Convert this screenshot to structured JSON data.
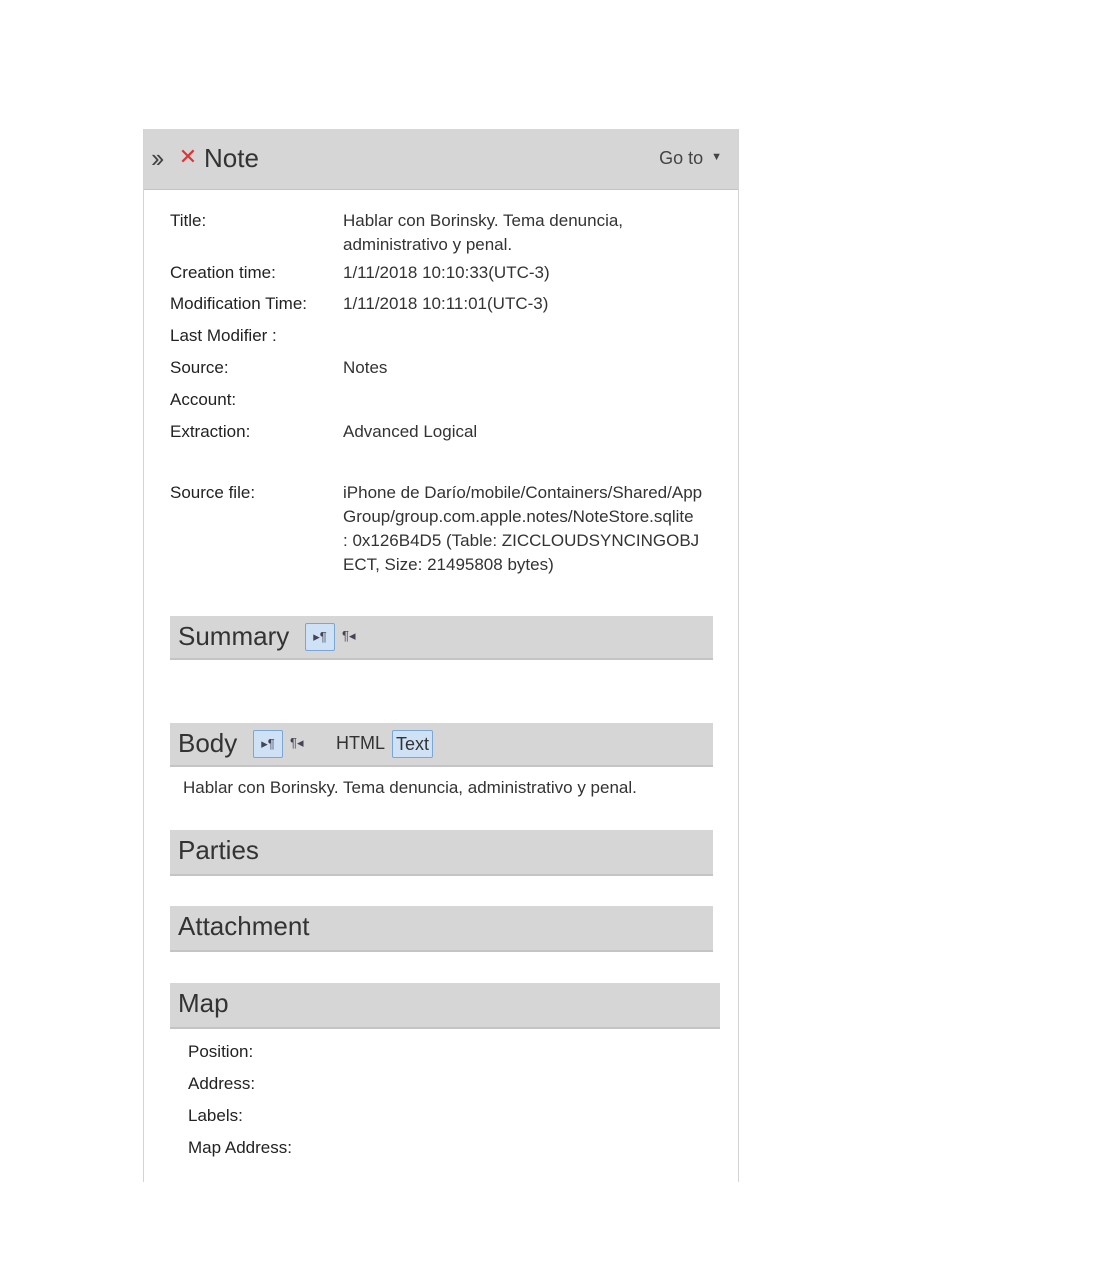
{
  "header": {
    "title": "Note",
    "goto_label": "Go to",
    "expand_icon": "double-chevron-right-icon",
    "close_icon": "red-x-icon"
  },
  "fields": [
    {
      "label": "Title:",
      "value": "Hablar con Borinsky. Tema denuncia, administrativo y penal."
    },
    {
      "label": "Creation time:",
      "value": "1/11/2018 10:10:33(UTC-3)"
    },
    {
      "label": "Modification Time:",
      "value": "1/11/2018 10:11:01(UTC-3)"
    },
    {
      "label": "Last Modifier :",
      "value": ""
    },
    {
      "label": "Source:",
      "value": "Notes"
    },
    {
      "label": "Account:",
      "value": ""
    },
    {
      "label": "Extraction:",
      "value": "Advanced Logical"
    },
    {
      "label": "Source file:",
      "value": "iPhone de Darío/mobile/Containers/Shared/AppGroup/group.com.apple.notes/NoteStore.sqlite : 0x126B4D5 (Table: ZICCLOUDSYNCINGOBJECT, Size: 21495808 bytes)"
    }
  ],
  "summary": {
    "title": "Summary"
  },
  "body": {
    "title": "Body",
    "html_label": "HTML",
    "text_label": "Text",
    "content": "Hablar con Borinsky. Tema denuncia, administrativo y penal."
  },
  "parties": {
    "title": "Parties"
  },
  "attachment": {
    "title": "Attachment"
  },
  "map": {
    "title": "Map",
    "fields": [
      "Position:",
      "Address:",
      "Labels:",
      "Map Address:"
    ]
  },
  "colors": {
    "header_bg": "#d6d6d6",
    "toggle_active": "#cfe2f5",
    "close_red": "#d33"
  }
}
